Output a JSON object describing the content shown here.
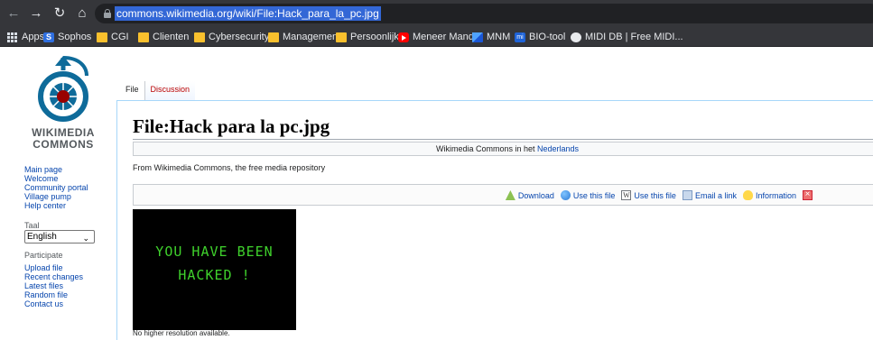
{
  "browser": {
    "url": "commons.wikimedia.org/wiki/File:Hack_para_la_pc.jpg",
    "bookmarks": [
      {
        "label": "Apps",
        "icon": "apps-grid-icon"
      },
      {
        "label": "Sophos",
        "icon": "sophos-icon"
      },
      {
        "label": "CGI",
        "icon": "folder-icon"
      },
      {
        "label": "Clienten",
        "icon": "folder-icon"
      },
      {
        "label": "Cybersecurity",
        "icon": "folder-icon"
      },
      {
        "label": "Management",
        "icon": "folder-icon"
      },
      {
        "label": "Persoonlijk",
        "icon": "folder-icon"
      },
      {
        "label": "Meneer Mandje",
        "icon": "youtube-icon"
      },
      {
        "label": "MNM",
        "icon": "mnm-icon"
      },
      {
        "label": "BIO-tool",
        "icon": "bio-tool-icon"
      },
      {
        "label": "MIDI DB | Free MIDI...",
        "icon": "globe-icon"
      }
    ]
  },
  "logo": {
    "line1": "WIKIMEDIA",
    "line2": "COMMONS"
  },
  "sidebar": {
    "main_links": [
      "Main page",
      "Welcome",
      "Community portal",
      "Village pump",
      "Help center"
    ],
    "language_heading": "Taal",
    "language_value": "English",
    "participate_heading": "Participate",
    "participate_links": [
      "Upload file",
      "Recent changes",
      "Latest files",
      "Random file",
      "Contact us"
    ]
  },
  "tabs": {
    "file": "File",
    "discussion": "Discussion"
  },
  "page": {
    "title": "File:Hack para la pc.jpg",
    "lang_notice_prefix": "Wikimedia Commons in het",
    "lang_notice_link": "Nederlands",
    "tagline": "From Wikimedia Commons, the free media repository",
    "tools": {
      "download": "Download",
      "use_file_1": "Use this file",
      "use_file_2": "Use this file",
      "email": "Email a link",
      "information": "Information"
    },
    "image_text_line1": "YOU HAVE BEEN",
    "image_text_line2": "HACKED !",
    "resolution_note": "No higher resolution available."
  },
  "colors": {
    "chrome_bg": "#35363a",
    "url_highlight": "#3367d6",
    "link": "#0645ad",
    "hacked_text": "#3fd12c"
  }
}
